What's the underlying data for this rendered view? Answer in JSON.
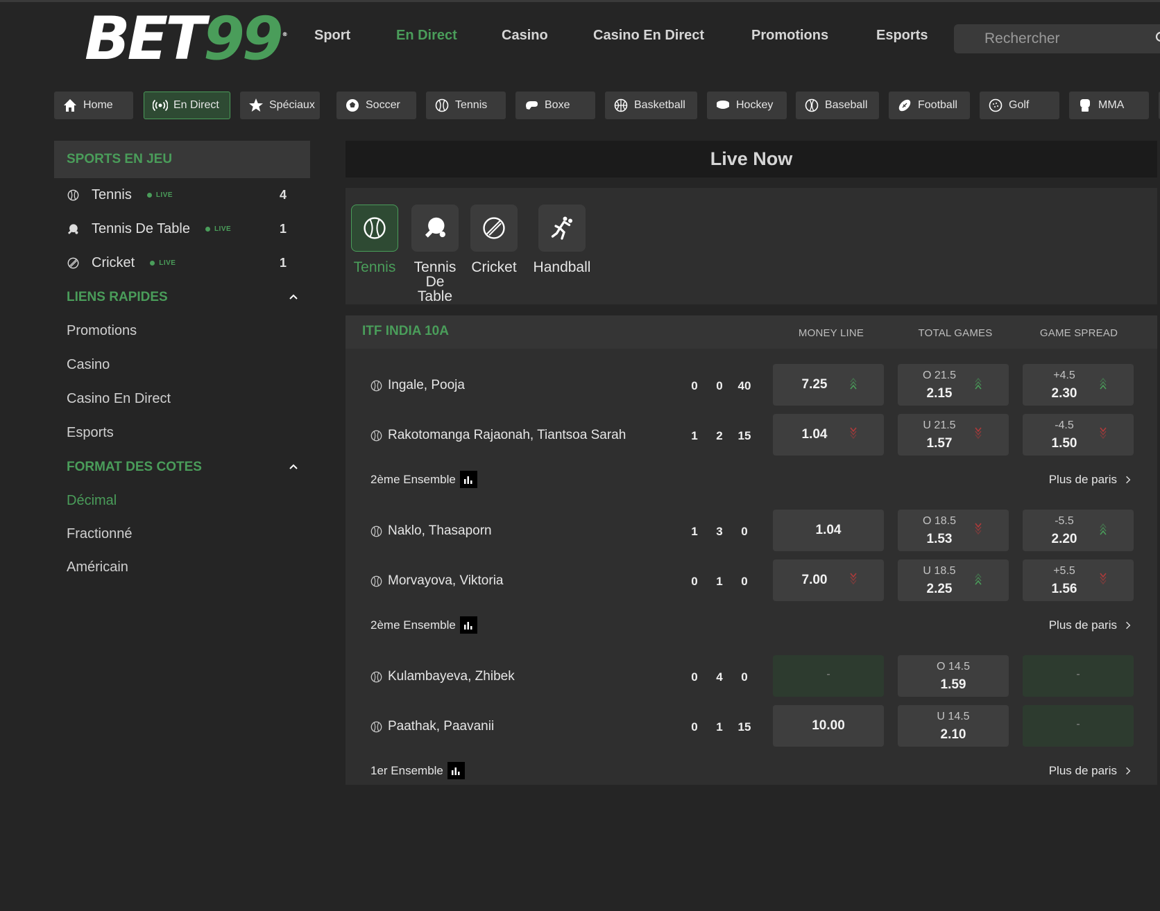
{
  "brand": {
    "logo_white": "BET",
    "logo_green": "99",
    "logo_mark": "®"
  },
  "nav": [
    "Sport",
    "En Direct",
    "Casino",
    "Casino En Direct",
    "Promotions",
    "Esports"
  ],
  "search": {
    "placeholder": "Rechercher"
  },
  "chips": [
    "Home",
    "En Direct",
    "Spéciaux",
    "Soccer",
    "Tennis",
    "Boxe",
    "Basketball",
    "Hockey",
    "Baseball",
    "Football",
    "Golf",
    "MMA"
  ],
  "sidebar": {
    "sports_header": "SPORTS EN JEU",
    "live_label": "LIVE",
    "sports": [
      {
        "name": "Tennis",
        "count": "4"
      },
      {
        "name": "Tennis De Table",
        "count": "1"
      },
      {
        "name": "Cricket",
        "count": "1"
      }
    ],
    "quick_links_header": "LIENS RAPIDES",
    "quick_links": [
      "Promotions",
      "Casino",
      "Casino En Direct",
      "Esports"
    ],
    "odds_format_header": "FORMAT DES COTES",
    "odds_formats": [
      "Décimal",
      "Fractionné",
      "Américain"
    ]
  },
  "main": {
    "title": "Live Now",
    "sport_tabs": [
      "Tennis",
      "Tennis De Table",
      "Cricket",
      "Handball"
    ],
    "league": "ITF INDIA 10A",
    "columns": [
      "MONEY LINE",
      "TOTAL GAMES",
      "GAME SPREAD"
    ],
    "more_label": "Plus de paris",
    "matches": [
      {
        "set_label": "2ème Ensemble",
        "players": [
          {
            "name": "Ingale, Pooja",
            "scores": [
              "0",
              "0",
              "40"
            ],
            "ml": "7.25",
            "ml_dir": "up",
            "tg_line": "O 21.5",
            "tg": "2.15",
            "tg_dir": "up",
            "gs_line": "+4.5",
            "gs": "2.30",
            "gs_dir": "up"
          },
          {
            "name": "Rakotomanga Rajaonah, Tiantsoa Sarah",
            "scores": [
              "1",
              "2",
              "15"
            ],
            "ml": "1.04",
            "ml_dir": "down",
            "tg_line": "U 21.5",
            "tg": "1.57",
            "tg_dir": "down",
            "gs_line": "-4.5",
            "gs": "1.50",
            "gs_dir": "down"
          }
        ]
      },
      {
        "set_label": "2ème Ensemble",
        "players": [
          {
            "name": "Naklo, Thasaporn",
            "scores": [
              "1",
              "3",
              "0"
            ],
            "ml": "1.04",
            "ml_dir": "",
            "tg_line": "O 18.5",
            "tg": "1.53",
            "tg_dir": "down",
            "gs_line": "-5.5",
            "gs": "2.20",
            "gs_dir": "up"
          },
          {
            "name": "Morvayova, Viktoria",
            "scores": [
              "0",
              "1",
              "0"
            ],
            "ml": "7.00",
            "ml_dir": "down",
            "tg_line": "U 18.5",
            "tg": "2.25",
            "tg_dir": "up",
            "gs_line": "+5.5",
            "gs": "1.56",
            "gs_dir": "down"
          }
        ]
      },
      {
        "set_label": "1er Ensemble",
        "players": [
          {
            "name": "Kulambayeva, Zhibek",
            "scores": [
              "0",
              "4",
              "0"
            ],
            "ml": "-",
            "ml_dir": "",
            "tg_line": "O 14.5",
            "tg": "1.59",
            "tg_dir": "",
            "gs_line": "",
            "gs": "-",
            "gs_dir": ""
          },
          {
            "name": "Paathak, Paavanii",
            "scores": [
              "0",
              "1",
              "15"
            ],
            "ml": "10.00",
            "ml_dir": "",
            "tg_line": "U 14.5",
            "tg": "2.10",
            "tg_dir": "",
            "gs_line": "",
            "gs": "-",
            "gs_dir": ""
          }
        ]
      }
    ]
  },
  "colors": {
    "accent": "#4a9d5a",
    "bg": "#252525",
    "panel": "#2f2f2f",
    "odd_bg": "#3e3e3e",
    "down": "#b03a3a"
  }
}
